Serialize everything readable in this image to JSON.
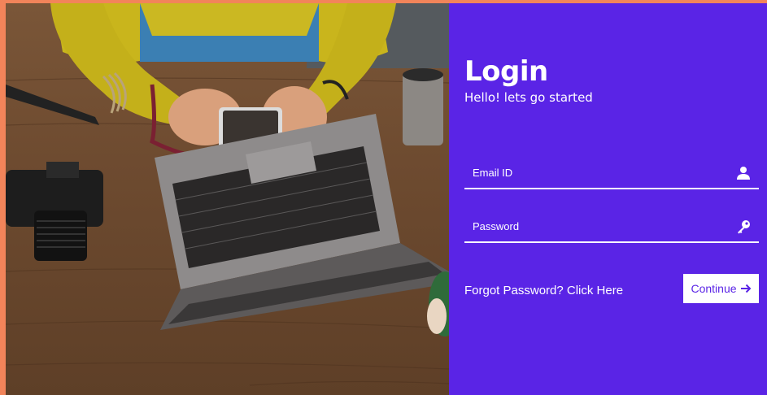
{
  "login": {
    "title": "Login",
    "subtitle": "Hello! lets go started",
    "email_placeholder": "Email ID",
    "email_icon": "user-icon",
    "password_placeholder": "Password",
    "password_icon": "key-icon",
    "forgot_text": "Forgot Password? Click Here",
    "continue_label": "Continue",
    "continue_icon": "arrow-right-icon"
  },
  "colors": {
    "page_background": "#f2845a",
    "panel_background": "#5a24e6",
    "text": "#ffffff",
    "button_text": "#5a24e6"
  }
}
